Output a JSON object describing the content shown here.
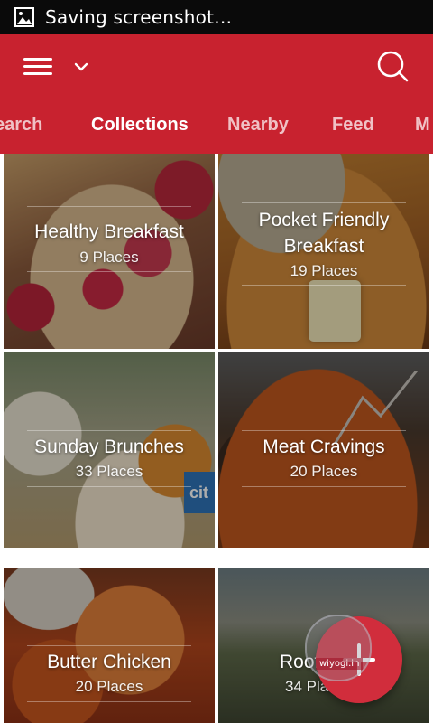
{
  "status_bar": {
    "text": "Saving screenshot…",
    "icon": "image-icon"
  },
  "app_bar": {
    "background": "#c8222f",
    "menu_icon": "hamburger-menu-icon",
    "dropdown_icon": "chevron-down-icon",
    "search_icon": "search-icon"
  },
  "tabs": [
    {
      "label": "earch",
      "active": false
    },
    {
      "label": "Collections",
      "active": true
    },
    {
      "label": "Nearby",
      "active": false
    },
    {
      "label": "Feed",
      "active": false
    },
    {
      "label": "M",
      "active": false
    }
  ],
  "collections": [
    {
      "title": "Healthy Breakfast",
      "count": "9 Places"
    },
    {
      "title": "Pocket Friendly",
      "title_line2": "Breakfast",
      "count": "19 Places"
    },
    {
      "title": "Sunday Brunches",
      "count": "33 Places"
    },
    {
      "title": "Meat Cravings",
      "count": "20 Places"
    },
    {
      "title": "Butter Chicken",
      "count": "20 Places"
    },
    {
      "title": "Roof",
      "count": "34 Places"
    }
  ],
  "card3_logo": "cit",
  "fab": {
    "icon": "plus-icon",
    "color": "#d12d3c"
  },
  "watermark": {
    "text": "wiyogi.in",
    "icon": "maple-leaf-icon"
  }
}
